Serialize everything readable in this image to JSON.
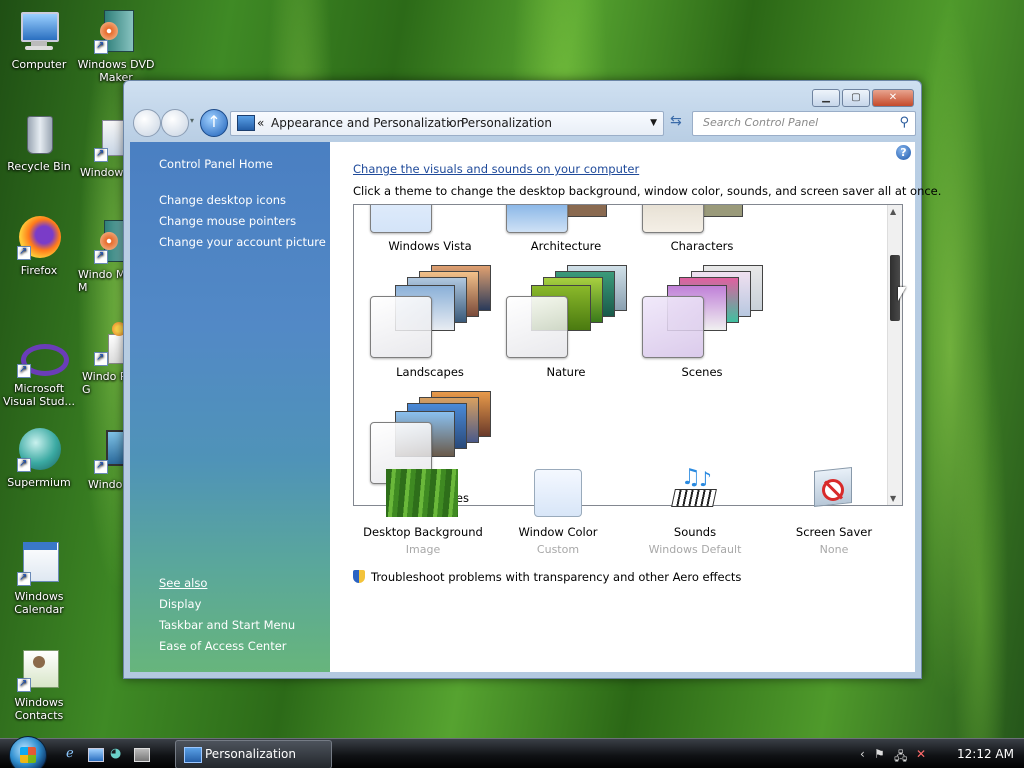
{
  "desktop": {
    "icons": [
      {
        "name": "Computer"
      },
      {
        "name": "Windows DVD Maker"
      },
      {
        "name": "Recycle Bin"
      },
      {
        "name": "Window"
      },
      {
        "name": "Firefox"
      },
      {
        "name": "Windo Movie M"
      },
      {
        "name": "Microsoft Visual Stud..."
      },
      {
        "name": "Windo Photo G"
      },
      {
        "name": "Supermium"
      },
      {
        "name": "Windo Sideb"
      },
      {
        "name": "Windows Calendar"
      },
      {
        "name": "Windows Contacts"
      }
    ]
  },
  "window": {
    "breadcrumb": {
      "chevrons": "«",
      "part1": "Appearance and Personalization",
      "sep": "›",
      "part2": "Personalization"
    },
    "search_placeholder": "Search Control Panel",
    "controls": {
      "minimize": "▁",
      "maximize": "▢",
      "close": "✕"
    }
  },
  "sidebar": {
    "home": "Control Panel Home",
    "tasks": [
      "Change desktop icons",
      "Change mouse pointers",
      "Change your account picture"
    ],
    "see_also_title": "See also",
    "see_also": [
      "Display",
      "Taskbar and Start Menu",
      "Ease of Access Center"
    ]
  },
  "content": {
    "heading": "Change the visuals and sounds on your computer",
    "description": "Click a theme to change the desktop background, window color, sounds, and screen saver all at once.",
    "themes": [
      {
        "name": "Windows Vista"
      },
      {
        "name": "Architecture"
      },
      {
        "name": "Characters"
      },
      {
        "name": "Landscapes"
      },
      {
        "name": "Nature"
      },
      {
        "name": "Scenes"
      },
      {
        "name": "United States"
      }
    ],
    "options": [
      {
        "label": "Desktop Background",
        "value": "Image",
        "icon": "desktop-background-icon"
      },
      {
        "label": "Window Color",
        "value": "Custom",
        "icon": "window-color-icon"
      },
      {
        "label": "Sounds",
        "value": "Windows Default",
        "icon": "sounds-icon"
      },
      {
        "label": "Screen Saver",
        "value": "None",
        "icon": "screen-saver-icon"
      }
    ],
    "troubleshoot": "Troubleshoot problems with transparency and other Aero effects"
  },
  "taskbar": {
    "task_label": "Personalization",
    "clock": "12:12 AM"
  },
  "colors": {
    "link": "#1f4a9a",
    "sidebar_top": "#4a7fc2",
    "sidebar_bottom": "#67b57c",
    "taskbar": "#101215"
  }
}
